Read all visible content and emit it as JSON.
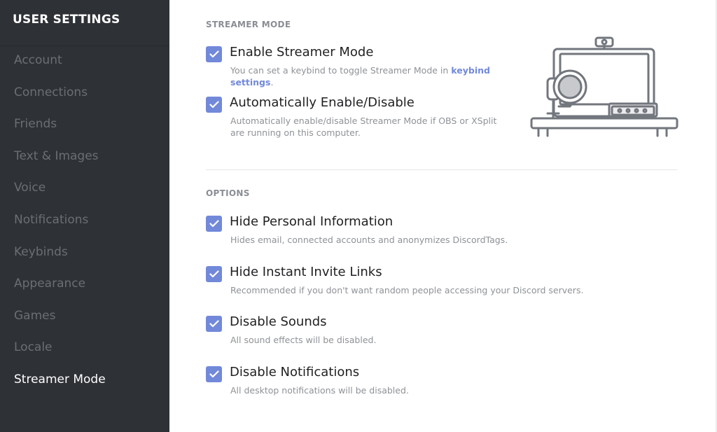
{
  "sidebar": {
    "title": "USER SETTINGS",
    "items": [
      {
        "label": "Account",
        "active": false
      },
      {
        "label": "Connections",
        "active": false
      },
      {
        "label": "Friends",
        "active": false
      },
      {
        "label": "Text & Images",
        "active": false
      },
      {
        "label": "Voice",
        "active": false
      },
      {
        "label": "Notifications",
        "active": false
      },
      {
        "label": "Keybinds",
        "active": false
      },
      {
        "label": "Appearance",
        "active": false
      },
      {
        "label": "Games",
        "active": false
      },
      {
        "label": "Locale",
        "active": false
      },
      {
        "label": "Streamer Mode",
        "active": true
      }
    ]
  },
  "streamer_mode": {
    "section_title": "STREAMER MODE",
    "enable": {
      "label": "Enable Streamer Mode",
      "checked": true,
      "desc_prefix": "You can set a keybind to toggle Streamer Mode in ",
      "desc_link": "keybind settings",
      "desc_suffix": "."
    },
    "auto": {
      "label": "Automatically Enable/Disable",
      "checked": true,
      "desc": "Automatically enable/disable Streamer Mode if OBS or XSplit are running on this computer."
    },
    "illustration_icon": "streaming-setup-illustration"
  },
  "options": {
    "section_title": "OPTIONS",
    "items": [
      {
        "label": "Hide Personal Information",
        "desc": "Hides email, connected accounts and anonymizes DiscordTags.",
        "checked": true
      },
      {
        "label": "Hide Instant Invite Links",
        "desc": "Recommended if you don't want random people accessing your Discord servers.",
        "checked": true
      },
      {
        "label": "Disable Sounds",
        "desc": "All sound effects will be disabled.",
        "checked": true
      },
      {
        "label": "Disable Notifications",
        "desc": "All desktop notifications will be disabled.",
        "checked": true
      }
    ]
  },
  "colors": {
    "accent": "#7289da",
    "sidebar_bg": "#2e3136",
    "sidebar_text": "#6b6e73",
    "active_text": "#ffffff"
  }
}
